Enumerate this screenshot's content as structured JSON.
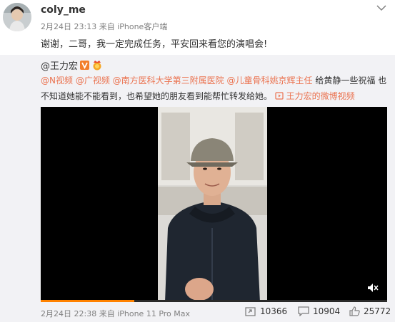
{
  "post": {
    "username": "coly_me",
    "time": "2月24日 23:13",
    "source": "来自 iPhone客户端",
    "text": "谢谢，二哥，我一定完成任务，平安回来看您的演唱会!"
  },
  "repost": {
    "author": "@王力宏",
    "tags": [
      "@N视频",
      "@广视频",
      "@南方医科大学第三附属医院",
      "@儿童骨科姚京辉主任"
    ],
    "text_part1": " 给黄静一些祝福 也",
    "text_part2": "不知道她能不能看到，也希望她的朋友看到能帮忙转发给她。",
    "video_link": "王力宏的微博视频",
    "video": {
      "progress": 0.27
    },
    "time": "2月24日 22:38",
    "source": "来自 iPhone 11 Pro Max",
    "stats": {
      "reposts": "10366",
      "comments": "10904",
      "likes": "25772"
    }
  },
  "icons": {
    "more": "chevron-down-icon",
    "vip": "verified-v-icon",
    "award": "award-badge-icon",
    "link": "video-link-icon",
    "mute": "mute-icon",
    "repost": "repost-icon",
    "comment": "comment-icon",
    "like": "like-icon"
  },
  "colors": {
    "accent": "#eb7350",
    "background": "#f2f2f5",
    "progress": "#ff8200"
  }
}
